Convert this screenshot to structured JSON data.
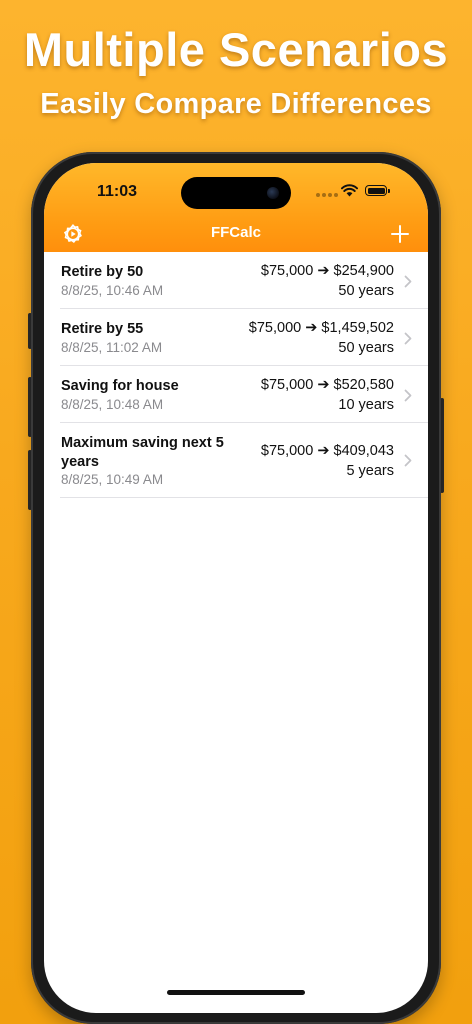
{
  "promo": {
    "headline": "Multiple Scenarios",
    "subheadline": "Easily Compare Differences"
  },
  "status_bar": {
    "time": "11:03"
  },
  "nav": {
    "title": "FFCalc",
    "left_icon": "settings-icon",
    "right_icon": "add-icon"
  },
  "scenarios": [
    {
      "title": "Retire by 50",
      "date": "8/8/25, 10:46 AM",
      "amount": "$75,000 ➔ $254,900",
      "years": "50 years"
    },
    {
      "title": "Retire by 55",
      "date": "8/8/25, 11:02 AM",
      "amount": "$75,000 ➔ $1,459,502",
      "years": "50 years"
    },
    {
      "title": "Saving for house",
      "date": "8/8/25, 10:48 AM",
      "amount": "$75,000 ➔ $520,580",
      "years": "10 years"
    },
    {
      "title": "Maximum saving next 5 years",
      "date": "8/8/25, 10:49 AM",
      "amount": "$75,000 ➔ $409,043",
      "years": "5 years"
    }
  ],
  "colors": {
    "background": "#F8A91E",
    "nav_bar": "#FF9B12",
    "secondary_text": "#8A8A8E"
  }
}
